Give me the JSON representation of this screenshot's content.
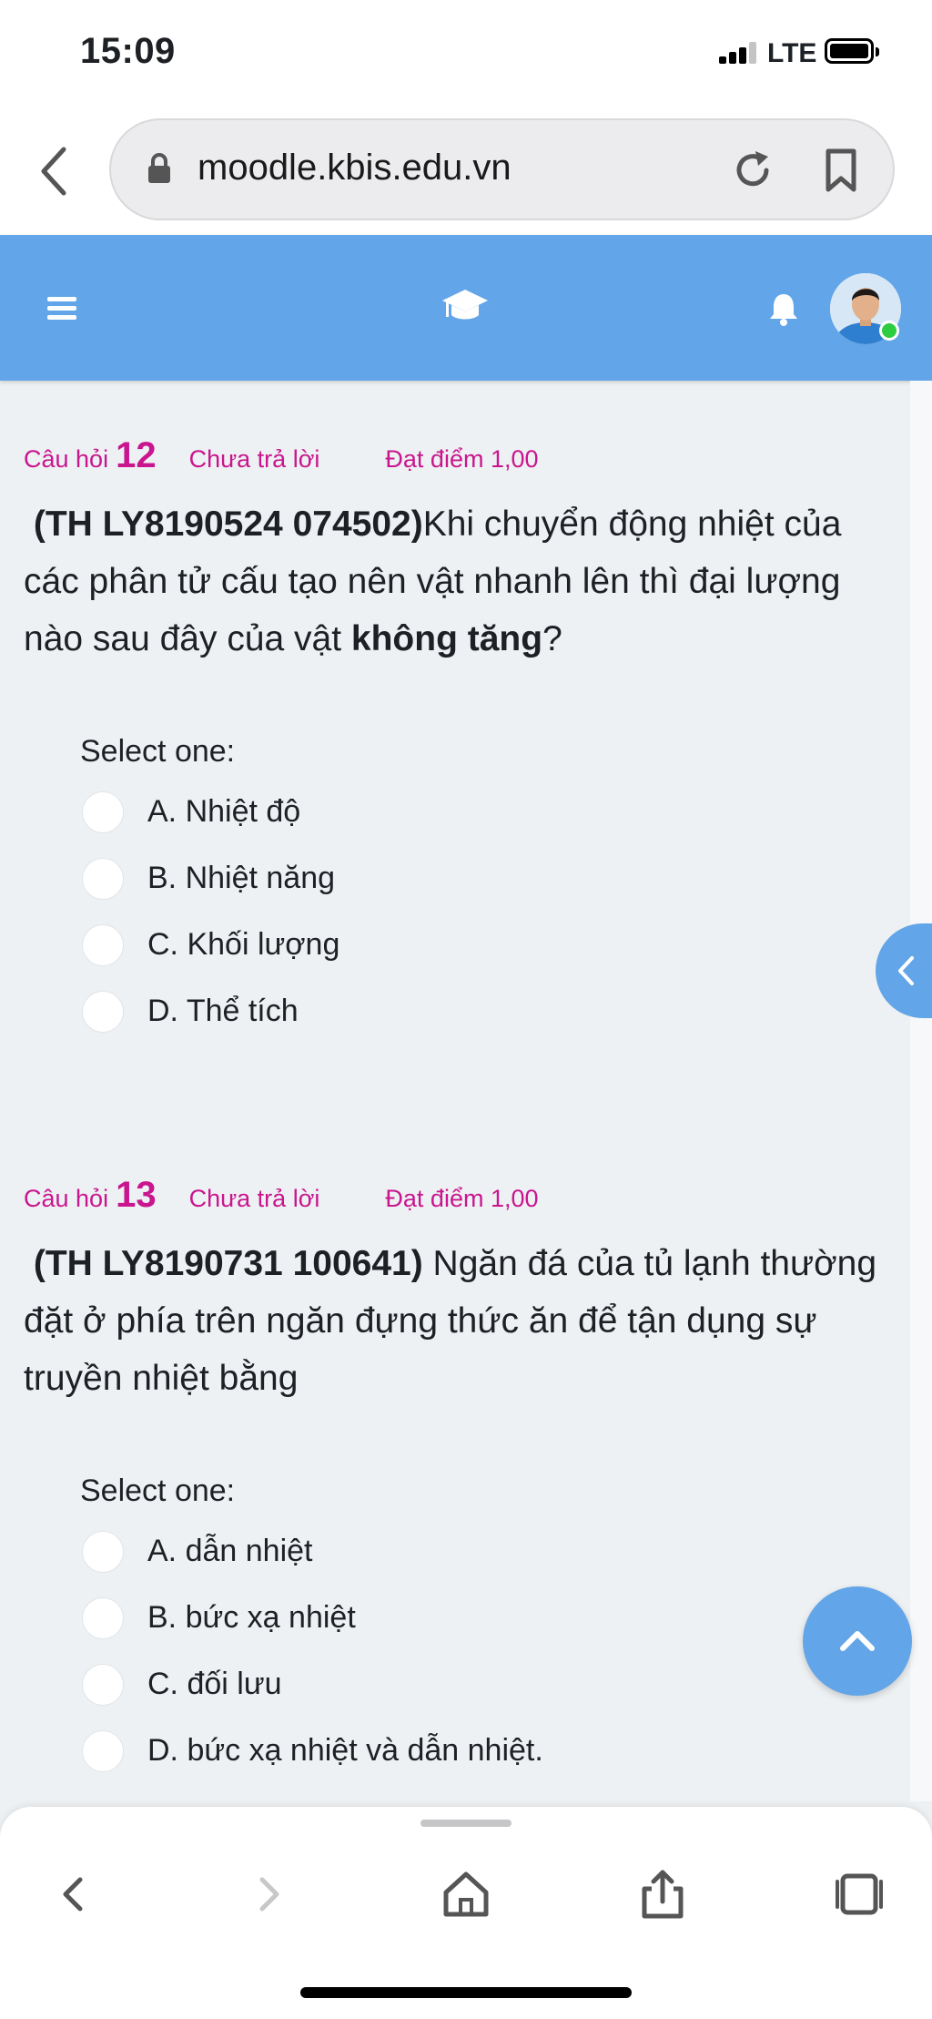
{
  "status_bar": {
    "time": "15:09",
    "network": "LTE"
  },
  "browser": {
    "url": "moodle.kbis.edu.vn"
  },
  "header": {
    "accent_color": "#62a5e8",
    "icons": [
      "hamburger-menu-icon",
      "graduation-cap-icon",
      "bell-icon",
      "avatar"
    ]
  },
  "questions": [
    {
      "label": "Câu hỏi",
      "number": "12",
      "state": "Chưa trả lời",
      "grade": "Đạt điểm 1,00",
      "code": "(TH LY8190524 074502)",
      "text_before": "Khi chuyển động nhiệt của các phân tử cấu tạo nên vật nhanh lên thì đại lượng nào sau đây của vật ",
      "text_emphasis": "không tăng",
      "text_after": "?",
      "prompt": "Select one:",
      "options": [
        "A. Nhiệt độ",
        "B. Nhiệt năng",
        "C. Khối lượng",
        "D. Thể tích"
      ]
    },
    {
      "label": "Câu hỏi",
      "number": "13",
      "state": "Chưa trả lời",
      "grade": "Đạt điểm 1,00",
      "code": "(TH LY8190731 100641)",
      "text_before": " Ngăn đá của tủ lạnh thường đặt ở phía trên ngăn đựng thức ăn để tận dụng sự truyền nhiệt bằng",
      "text_emphasis": "",
      "text_after": "",
      "prompt": "Select one:",
      "options": [
        "A. dẫn nhiệt",
        "B. bức xạ nhiệt",
        "C. đối lưu",
        "D. bức xạ nhiệt và dẫn nhiệt."
      ]
    }
  ],
  "colors": {
    "question_info": "#c9168f",
    "page_background": "#eef1f3"
  }
}
